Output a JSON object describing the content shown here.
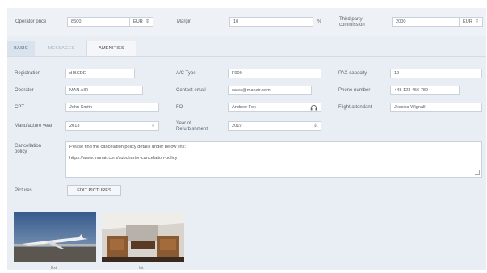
{
  "top": {
    "operator_price_label": "Operator price",
    "operator_price_value": "8500",
    "operator_price_currency": "EUR",
    "margin_label": "Margin",
    "margin_value": "10",
    "margin_unit": "%",
    "third_party_label_1": "Third party",
    "third_party_label_2": "commission",
    "third_party_value": "2000",
    "third_party_currency": "EUR"
  },
  "tabs": [
    "BASIC",
    "MESSAGES",
    "AMENITIES"
  ],
  "form": {
    "registration_label": "Registration",
    "registration_value": "d-BCDE",
    "ac_type_label": "A/C Type",
    "ac_type_value": "F900",
    "pax_label": "PAX capacity",
    "pax_value": "19",
    "operator_label": "Operator",
    "operator_value": "MAN AIR",
    "contact_email_label": "Contact email",
    "contact_email_value": "sales@manair.com",
    "phone_label": "Phone number",
    "phone_value": "+48 123 456 789",
    "cpt_label": "CPT",
    "cpt_value": "John Smith",
    "fo_label": "FO",
    "fo_value": "Andrew Fox",
    "fa_label": "Flight attendant",
    "fa_value": "Jessica Wignall",
    "manufacture_label": "Manufacture year",
    "manufacture_value": "2013",
    "refurb_label_1": "Year of",
    "refurb_label_2": "Refurbishment",
    "refurb_value": "2019",
    "cancellation_label_1": "Cancellation",
    "cancellation_label_2": "policy",
    "cancellation_line1": "Please find the cancelation policy details under below link:",
    "cancellation_line2": "https://www.manair.com/subcharter-cancelation-policy",
    "pictures_label": "Pictures",
    "edit_pictures_label": "EDIT PICTURES"
  },
  "pictures": [
    {
      "caption": "Ext"
    },
    {
      "caption": "Int"
    }
  ],
  "colors": {
    "panel": "#e9eef4",
    "tab_active": "#d9e3ee"
  },
  "icons": {
    "fo_field": "headset-icon",
    "select_arrow": "updown-chevron-icon"
  }
}
